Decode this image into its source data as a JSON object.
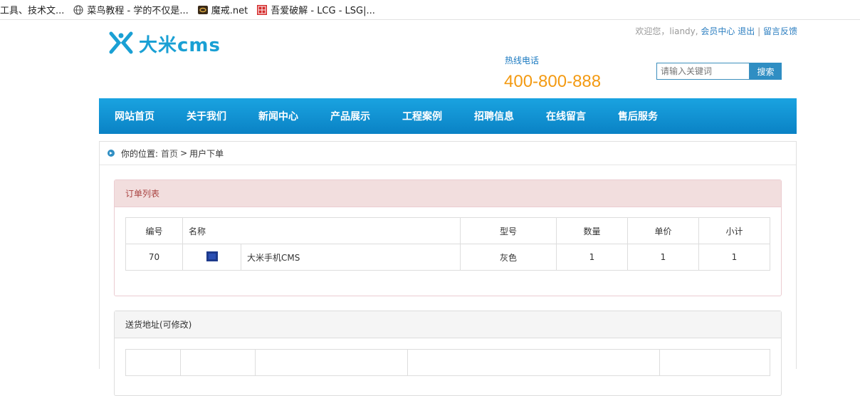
{
  "bookmarks": [
    {
      "label": "工具、技术文...",
      "icon": "none"
    },
    {
      "label": "菜鸟教程 - 学的不仅是...",
      "icon": "globe-icon"
    },
    {
      "label": "魔戒.net",
      "icon": "ring-icon"
    },
    {
      "label": "吾爱破解 - LCG - LSG|...",
      "icon": "red-seal-icon"
    }
  ],
  "header": {
    "logo_text": "大米cms",
    "welcome": "欢迎您，liandy,",
    "member_center": "会员中心",
    "logout": "退出",
    "separator": "|",
    "feedback": "留言反馈",
    "hotline_label": "热线电话",
    "hotline_number": "400-800-888",
    "search_placeholder": "请输入关键词",
    "search_button": "搜索"
  },
  "nav": [
    "网站首页",
    "关于我们",
    "新闻中心",
    "产品展示",
    "工程案例",
    "招聘信息",
    "在线留言",
    "售后服务"
  ],
  "breadcrumb": {
    "prefix": "你的位置:",
    "home": "首页",
    "sep": ">",
    "current": "用户下单"
  },
  "orders": {
    "title": "订单列表",
    "headers": [
      "编号",
      "名称",
      "型号",
      "数量",
      "单价",
      "小计"
    ],
    "rows": [
      {
        "id": "70",
        "name": "大米手机CMS",
        "model": "灰色",
        "qty": "1",
        "price": "1",
        "subtotal": "1"
      }
    ]
  },
  "address": {
    "title": "送货地址(可修改)"
  },
  "colors": {
    "brand": "#1aa0d4",
    "hotline": "#f39a12",
    "nav": "#0a82c5"
  }
}
